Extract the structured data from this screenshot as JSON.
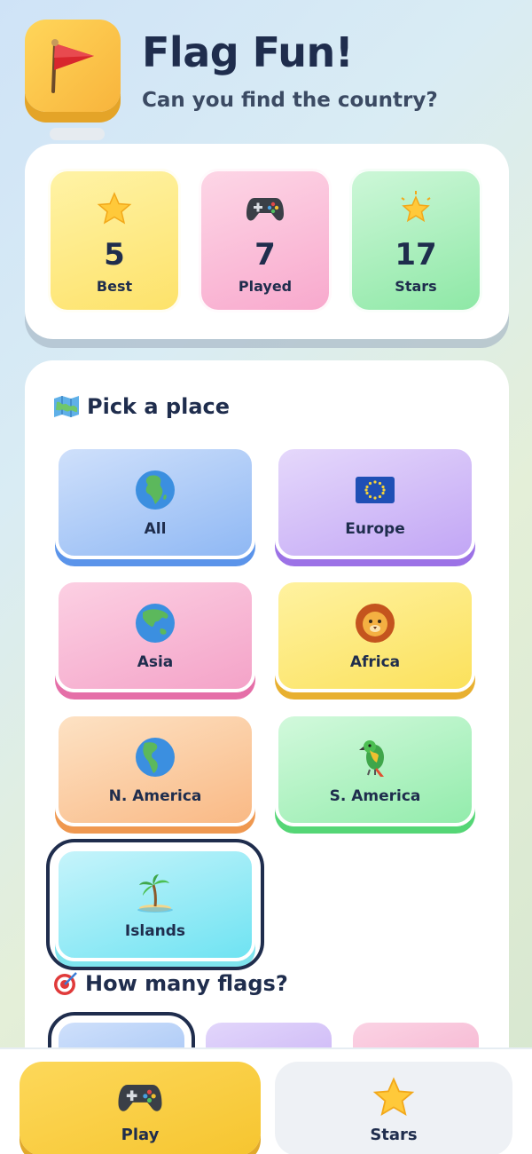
{
  "header": {
    "title": "Flag Fun!",
    "subtitle": "Can you find the country?"
  },
  "stats": [
    {
      "value": "5",
      "label": "Best",
      "icon": "star-icon"
    },
    {
      "value": "7",
      "label": "Played",
      "icon": "gamepad-icon"
    },
    {
      "value": "17",
      "label": "Stars",
      "icon": "glowing-star-icon"
    }
  ],
  "pick": {
    "title": "Pick a place",
    "regions": [
      {
        "label": "All",
        "icon": "globe-africa-icon"
      },
      {
        "label": "Europe",
        "icon": "eu-flag-icon"
      },
      {
        "label": "Asia",
        "icon": "globe-asia-icon"
      },
      {
        "label": "Africa",
        "icon": "lion-icon"
      },
      {
        "label": "N. America",
        "icon": "globe-americas-icon"
      },
      {
        "label": "S. America",
        "icon": "parrot-icon"
      },
      {
        "label": "Islands",
        "icon": "palm-island-icon"
      }
    ],
    "selected": "Islands"
  },
  "count": {
    "title": "How many flags?"
  },
  "nav": {
    "play": "Play",
    "stars": "Stars"
  },
  "colors": {
    "ink": "#1f2d4d",
    "accent_yellow": "#f8b43c"
  }
}
